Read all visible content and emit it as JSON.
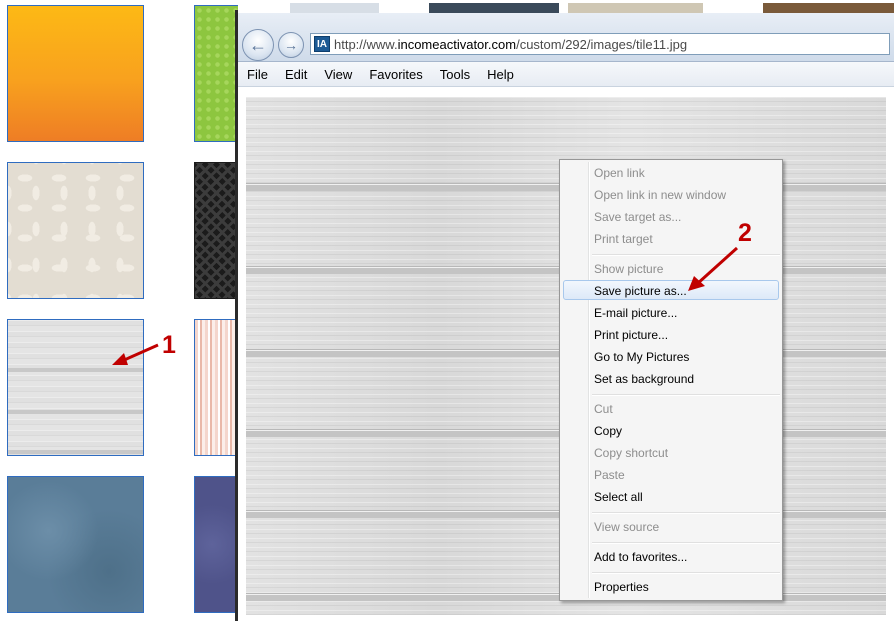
{
  "thumbnails": [
    {
      "name": "orange-gradient-tile"
    },
    {
      "name": "green-dots-tile"
    },
    {
      "name": "floral-beige-tile"
    },
    {
      "name": "black-maze-tile"
    },
    {
      "name": "gray-wood-tile"
    },
    {
      "name": "pink-stripes-tile"
    },
    {
      "name": "blue-texture-tile"
    },
    {
      "name": "navy-texture-tile"
    }
  ],
  "browser": {
    "url_prefix": "http://www.",
    "url_domain": "incomeactivator.com",
    "url_path": "/custom/292/images/tile11.jpg",
    "site_icon_text": "IA",
    "menu": [
      "File",
      "Edit",
      "View",
      "Favorites",
      "Tools",
      "Help"
    ]
  },
  "context_menu": {
    "items": [
      {
        "label": "Open link",
        "enabled": false
      },
      {
        "label": "Open link in new window",
        "enabled": false
      },
      {
        "label": "Save target as...",
        "enabled": false
      },
      {
        "label": "Print target",
        "enabled": false
      },
      {
        "label": "Show picture",
        "enabled": false
      },
      {
        "label": "Save picture as...",
        "enabled": true,
        "highlighted": true
      },
      {
        "label": "E-mail picture...",
        "enabled": true
      },
      {
        "label": "Print picture...",
        "enabled": true
      },
      {
        "label": "Go to My Pictures",
        "enabled": true
      },
      {
        "label": "Set as background",
        "enabled": true
      },
      {
        "label": "Cut",
        "enabled": false
      },
      {
        "label": "Copy",
        "enabled": true
      },
      {
        "label": "Copy shortcut",
        "enabled": false
      },
      {
        "label": "Paste",
        "enabled": false
      },
      {
        "label": "Select all",
        "enabled": true
      },
      {
        "label": "View source",
        "enabled": false
      },
      {
        "label": "Add to favorites...",
        "enabled": true
      },
      {
        "label": "Properties",
        "enabled": true
      }
    ]
  },
  "annotations": {
    "step1": "1",
    "step2": "2",
    "color": "#c00000"
  }
}
